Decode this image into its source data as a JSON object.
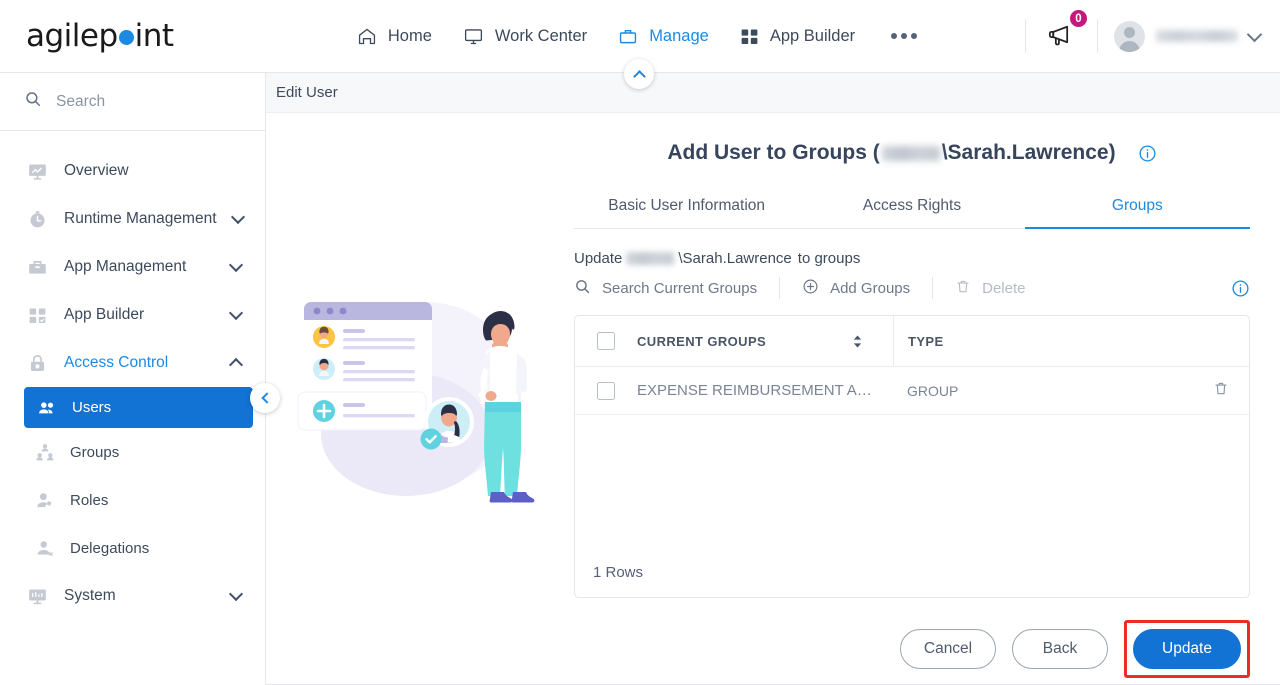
{
  "brand": {
    "name_before": "agilep",
    "name_after": "int",
    "dot": "o-dot"
  },
  "topnav": {
    "items": [
      {
        "label": "Home",
        "icon": "home-icon",
        "active": false
      },
      {
        "label": "Work Center",
        "icon": "monitor-icon",
        "active": false
      },
      {
        "label": "Manage",
        "icon": "briefcase-icon",
        "active": true
      },
      {
        "label": "App Builder",
        "icon": "grid-icon",
        "active": false
      }
    ],
    "more_label": "more-menu",
    "announcement_count": "0",
    "user_name_redacted": true
  },
  "sidebar": {
    "search_placeholder": "Search",
    "items": [
      {
        "label": "Overview",
        "icon": "overview-icon",
        "caret": "none",
        "state": "normal"
      },
      {
        "label": "Runtime Management",
        "icon": "clock-icon",
        "caret": "down",
        "state": "normal"
      },
      {
        "label": "App Management",
        "icon": "toolbox-icon",
        "caret": "down",
        "state": "normal"
      },
      {
        "label": "App Builder",
        "icon": "grid-icon",
        "caret": "down",
        "state": "normal"
      },
      {
        "label": "Access Control",
        "icon": "lock-icon",
        "caret": "up",
        "state": "expanded"
      }
    ],
    "sub_items": [
      {
        "label": "Users",
        "icon": "users-icon",
        "active": true
      },
      {
        "label": "Groups",
        "icon": "group-icon",
        "active": false
      },
      {
        "label": "Roles",
        "icon": "role-icon",
        "active": false
      },
      {
        "label": "Delegations",
        "icon": "delegation-icon",
        "active": false
      }
    ],
    "footer_items": [
      {
        "label": "System",
        "icon": "system-icon",
        "caret": "down"
      }
    ]
  },
  "page": {
    "header_title": "Edit User",
    "form_title_prefix": "Add User to Groups (",
    "form_title_user": "\\Sarah.Lawrence",
    "form_title_suffix": ")",
    "tabs": [
      {
        "label": "Basic User Information",
        "active": false
      },
      {
        "label": "Access Rights",
        "active": false
      },
      {
        "label": "Groups",
        "active": true
      }
    ],
    "update_line_prefix": "Update",
    "update_line_user": "\\Sarah.Lawrence",
    "update_line_suffix": "to groups",
    "toolbar": {
      "search_placeholder": "Search Current Groups",
      "add_label": "Add Groups",
      "delete_label": "Delete",
      "delete_disabled": true,
      "info_label": "info-icon"
    },
    "table": {
      "columns": [
        "CURRENT GROUPS",
        "TYPE"
      ],
      "rows": [
        {
          "name": "EXPENSE REIMBURSEMENT APPROVE…",
          "type": "GROUP"
        }
      ],
      "footer": "1 Rows"
    },
    "buttons": {
      "cancel": "Cancel",
      "back": "Back",
      "update": "Update"
    }
  },
  "colors": {
    "accent": "#1b8ae5",
    "primary_button": "#1273d4",
    "badge": "#c2197c",
    "highlight": "#ee2b24",
    "sidebar_active": "#1273d4"
  }
}
